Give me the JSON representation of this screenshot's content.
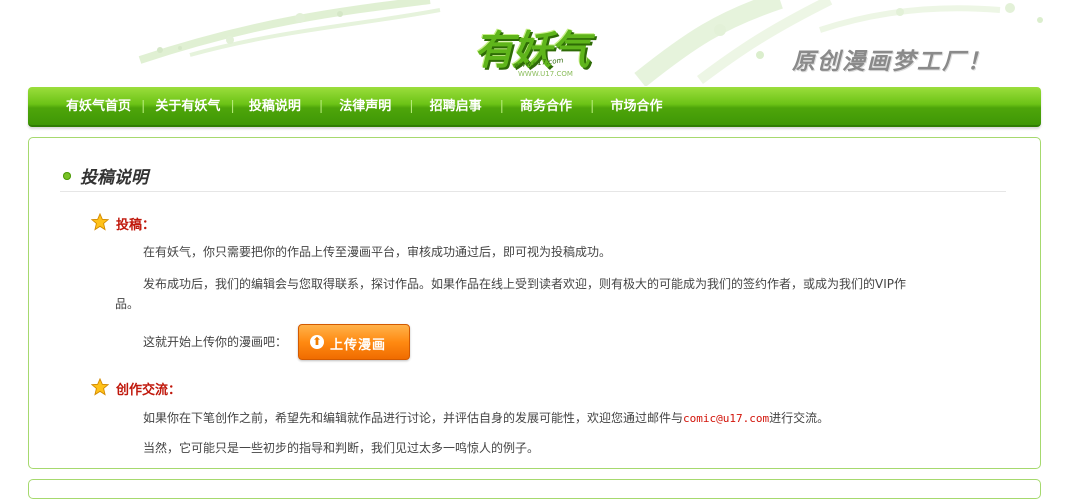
{
  "header": {
    "logo_text": "有妖气",
    "logo_url_1": "www.u17.com",
    "logo_url_2": "WWW.U17.COM",
    "slogan": "原创漫画梦工厂！"
  },
  "nav": {
    "items": [
      {
        "label": "有妖气首页"
      },
      {
        "label": "关于有妖气"
      },
      {
        "label": "投稿说明"
      },
      {
        "label": "法律声明"
      },
      {
        "label": "招聘启事"
      },
      {
        "label": "商务合作"
      },
      {
        "label": "市场合作"
      }
    ]
  },
  "content": {
    "title": "投稿说明",
    "section1": {
      "heading": "投稿：",
      "p1": "在有妖气，你只需要把你的作品上传至漫画平台，审核成功通过后，即可视为投稿成功。",
      "p2_line1": "发布成功后，我们的编辑会与您取得联系，探讨作品。如果作品在线上受到读者欢迎，则有极大的可能成为我们的签约作者，或成为我们的VIP作",
      "p2_line2": "品。",
      "p3": "这就开始上传你的漫画吧：",
      "upload_button": "上传漫画"
    },
    "section2": {
      "heading": "创作交流：",
      "p1_before": "如果你在下笔创作之前，希望先和编辑就作品进行讨论，并评估自身的发展可能性，欢迎您通过邮件与",
      "email": "comic@u17.com",
      "p1_after": "进行交流。",
      "p2": "当然，它可能只是一些初步的指导和判断，我们见过太多一鸣惊人的例子。"
    }
  },
  "colors": {
    "nav_green": "#5cb512",
    "heading_red": "#c0180c",
    "button_orange": "#ff8a12",
    "panel_border": "#a6d96e"
  }
}
